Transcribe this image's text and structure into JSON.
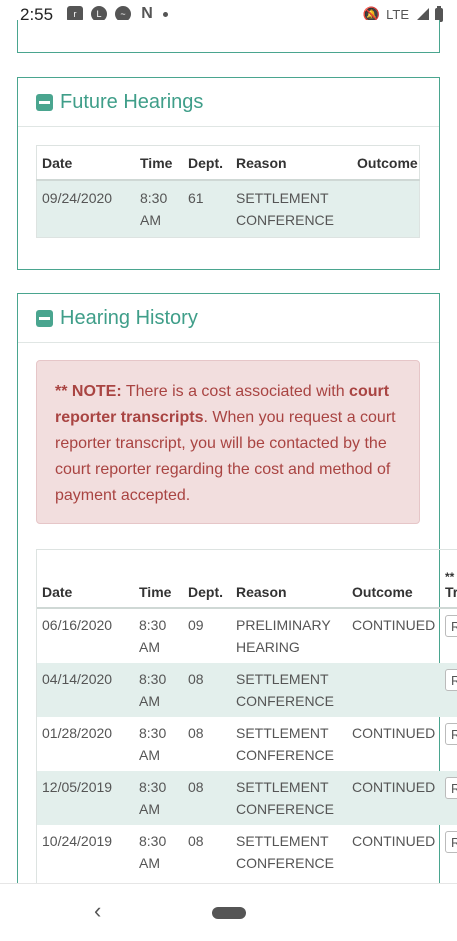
{
  "status_bar": {
    "time": "2:55",
    "app_icons": [
      "ring-icon",
      "line-icon",
      "messenger-icon",
      "netflix-icon"
    ],
    "network": "LTE"
  },
  "future_hearings": {
    "title": "Future Hearings",
    "columns": [
      "Date",
      "Time",
      "Dept.",
      "Reason",
      "Outcome"
    ],
    "rows": [
      {
        "date": "09/24/2020",
        "time": "8:30 AM",
        "dept": "61",
        "reason": "SETTLEMENT CONFERENCE",
        "outcome": ""
      }
    ]
  },
  "hearing_history": {
    "title": "Hearing History",
    "note_label": "** NOTE:",
    "note_text_1": " There is a cost associated with ",
    "note_bold": "court reporter transcripts",
    "note_text_2": ". When you request a court reporter transcript, you will be contacted by the court reporter regarding the cost and method of payment accepted.",
    "columns": [
      "Date",
      "Time",
      "Dept.",
      "Reason",
      "Outcome",
      "Tra"
    ],
    "extra_header_prefix": "**",
    "rows": [
      {
        "date": "06/16/2020",
        "time": "8:30 AM",
        "dept": "09",
        "reason": "PRELIMINARY HEARING",
        "outcome": "CONTINUED",
        "action": "R"
      },
      {
        "date": "04/14/2020",
        "time": "8:30 AM",
        "dept": "08",
        "reason": "SETTLEMENT CONFERENCE",
        "outcome": "",
        "action": "R"
      },
      {
        "date": "01/28/2020",
        "time": "8:30 AM",
        "dept": "08",
        "reason": "SETTLEMENT CONFERENCE",
        "outcome": "CONTINUED",
        "action": "R"
      },
      {
        "date": "12/05/2019",
        "time": "8:30 AM",
        "dept": "08",
        "reason": "SETTLEMENT CONFERENCE",
        "outcome": "CONTINUED",
        "action": "R"
      },
      {
        "date": "10/24/2019",
        "time": "8:30 AM",
        "dept": "08",
        "reason": "SETTLEMENT CONFERENCE",
        "outcome": "CONTINUED",
        "action": "R"
      }
    ]
  },
  "colors": {
    "accent": "#4aa58f",
    "row_alt": "#e3efec",
    "note_bg": "#f2dede",
    "note_text": "#a94442"
  }
}
